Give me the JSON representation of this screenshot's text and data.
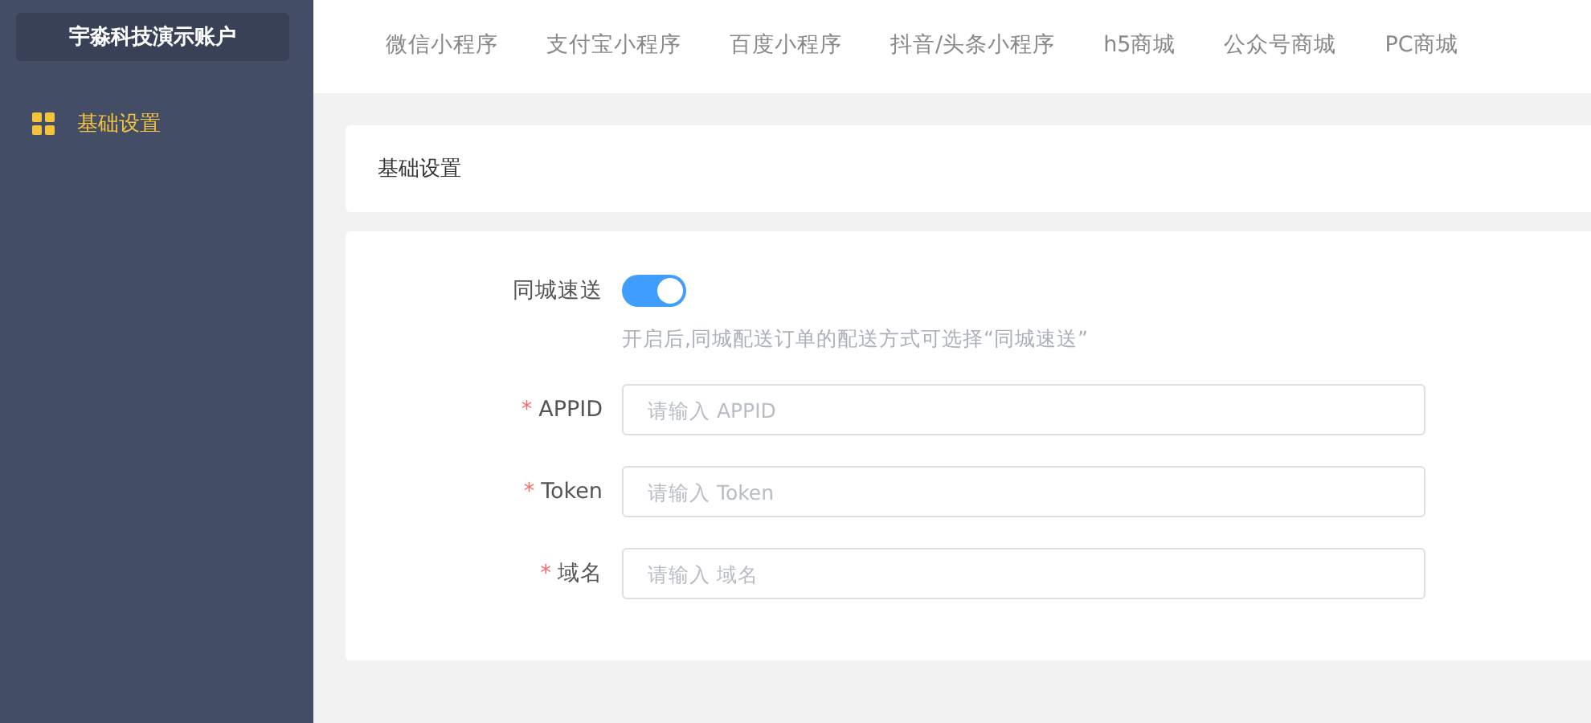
{
  "sidebar": {
    "account": "宇淼科技演示账户",
    "items": [
      {
        "label": "基础设置",
        "selected": true
      }
    ]
  },
  "tabs": [
    {
      "label": "微信小程序",
      "selected": false
    },
    {
      "label": "支付宝小程序",
      "selected": false
    },
    {
      "label": "百度小程序",
      "selected": false
    },
    {
      "label": "抖音/头条小程序",
      "selected": false
    },
    {
      "label": "h5商城",
      "selected": false
    },
    {
      "label": "公众号商城",
      "selected": false
    },
    {
      "label": "PC商城",
      "selected": false
    }
  ],
  "section_title": "基础设置",
  "form": [
    {
      "kind": "switch",
      "label": "同城速送",
      "on": true,
      "hint": "开启后,同城配送订单的配送方式可选择“同城速送”"
    },
    {
      "kind": "input",
      "label": "APPID",
      "required_mark": "*",
      "placeholder": "请输入 APPID"
    },
    {
      "kind": "input",
      "label": "Token",
      "required_mark": "*",
      "placeholder": "请输入 Token"
    },
    {
      "kind": "input",
      "label": "域名",
      "required_mark": "*",
      "placeholder": "请输入 域名"
    }
  ]
}
